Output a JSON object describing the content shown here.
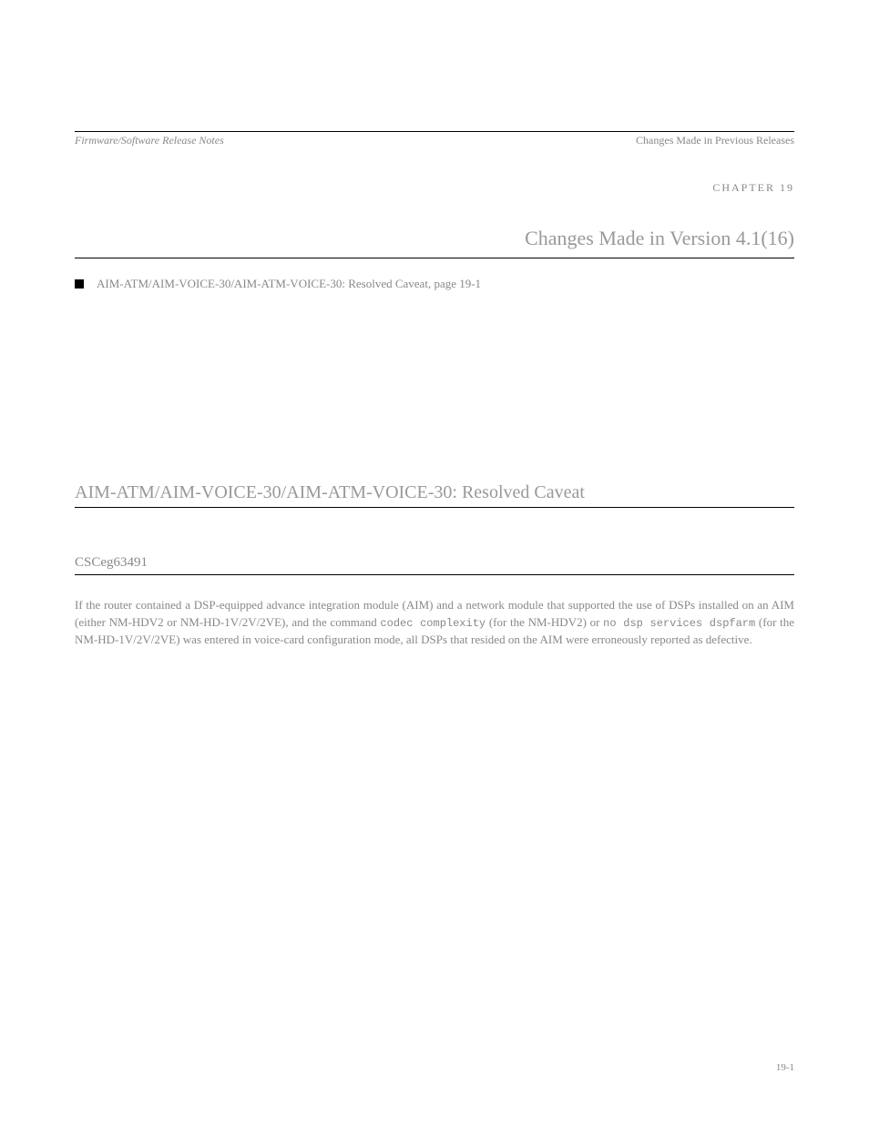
{
  "header": {
    "left": "Firmware/Software Release Notes",
    "right": "Changes Made in Previous Releases",
    "chapter_label": "CHAPTER 19",
    "chapter_title": "Changes Made in Version 4.1(16)"
  },
  "toc": {
    "item": "AIM-ATM/AIM-VOICE-30/AIM-ATM-VOICE-30: Resolved Caveat, page 19-1"
  },
  "section": {
    "heading": "AIM-ATM/AIM-VOICE-30/AIM-ATM-VOICE-30: Resolved Caveat",
    "subheading": "CSCeg63491",
    "paragraph_prefix": "If the router contained a DSP-equipped advance integration module (AIM) and a network module that supported the use of DSPs installed on an AIM (either NM-HDV2 or NM-HD-1V/2V/2VE), and the command ",
    "cmd1": "codec complexity",
    "paragraph_mid1": " (for the NM-HDV2) or ",
    "cmd2": "no dsp services dspfarm",
    "paragraph_mid2": " (for the NM-HD-1V/2V/2VE) was entered in voice-card configuration mode, all DSPs that resided on the AIM were erroneously reported as defective."
  },
  "page_number": "19-1"
}
